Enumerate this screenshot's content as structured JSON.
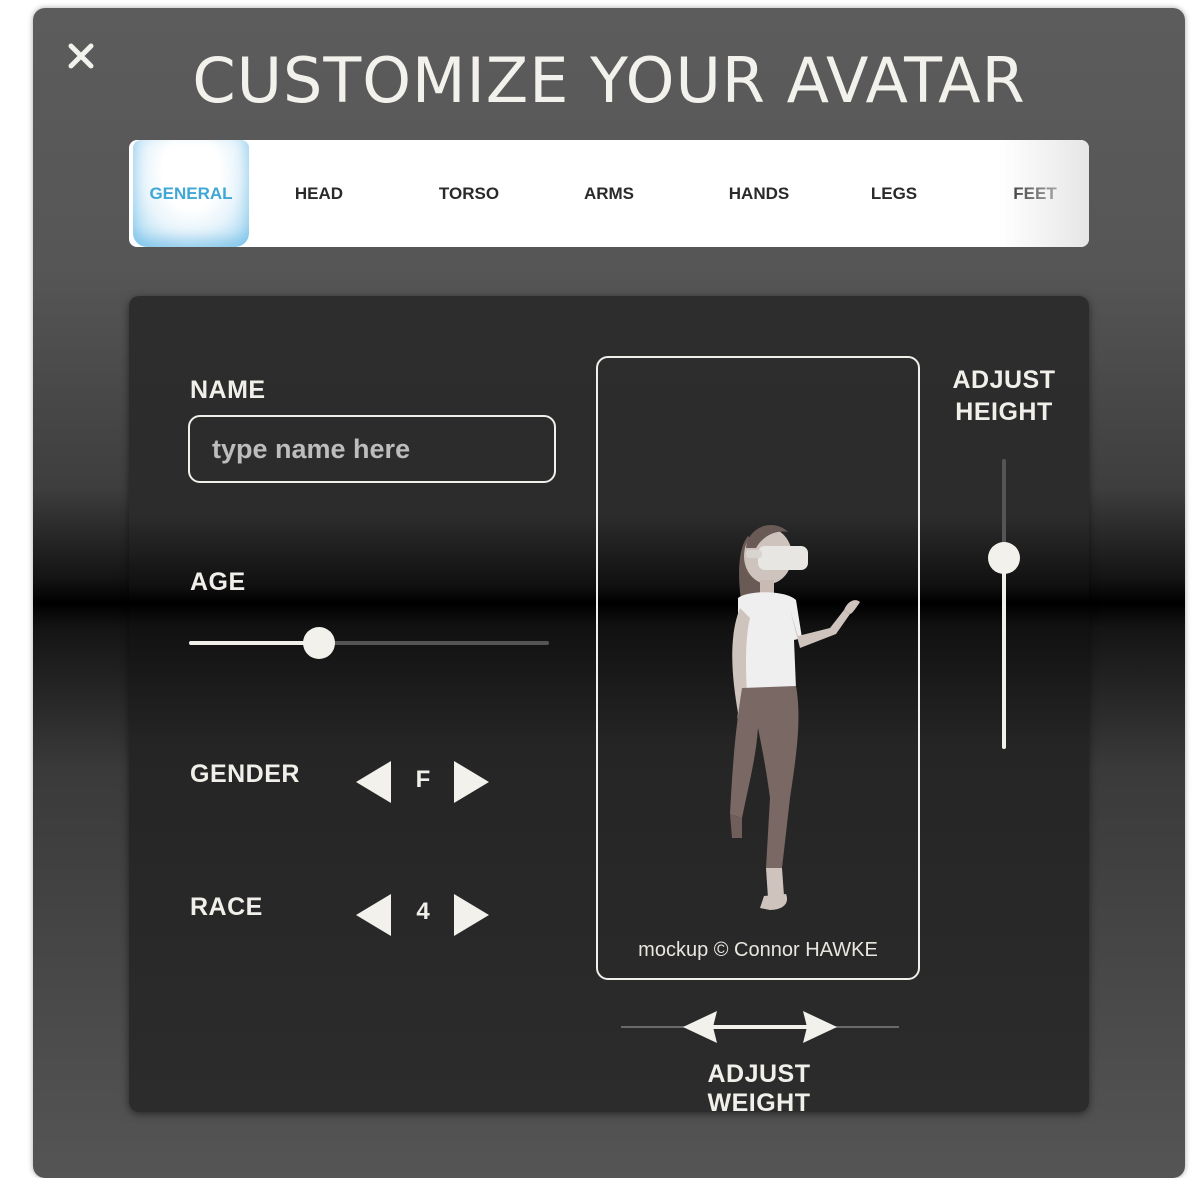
{
  "dialog": {
    "title": "CUSTOMIZE YOUR AVATAR",
    "close_icon": "close-icon"
  },
  "tabs": [
    {
      "label": "GENERAL",
      "active": true
    },
    {
      "label": "HEAD",
      "active": false
    },
    {
      "label": "TORSO",
      "active": false
    },
    {
      "label": "ARMS",
      "active": false
    },
    {
      "label": "HANDS",
      "active": false
    },
    {
      "label": "LEGS",
      "active": false
    },
    {
      "label": "FEET",
      "active": false
    }
  ],
  "form": {
    "name_label": "NAME",
    "name_value": "",
    "name_placeholder": "type name here",
    "age_label": "AGE",
    "age_level": 0.36,
    "gender_label": "GENDER",
    "gender_value": "F",
    "race_label": "RACE",
    "race_value": "4"
  },
  "preview": {
    "watermark": "mockup © Connor HAWKE"
  },
  "height": {
    "label_line1": "ADJUST",
    "label_line2": "HEIGHT",
    "level": 0.66
  },
  "weight": {
    "label": "ADJUST WEIGHT"
  },
  "colors": {
    "accent_tab": "#3fa7d6",
    "text": "#f1efe9"
  }
}
